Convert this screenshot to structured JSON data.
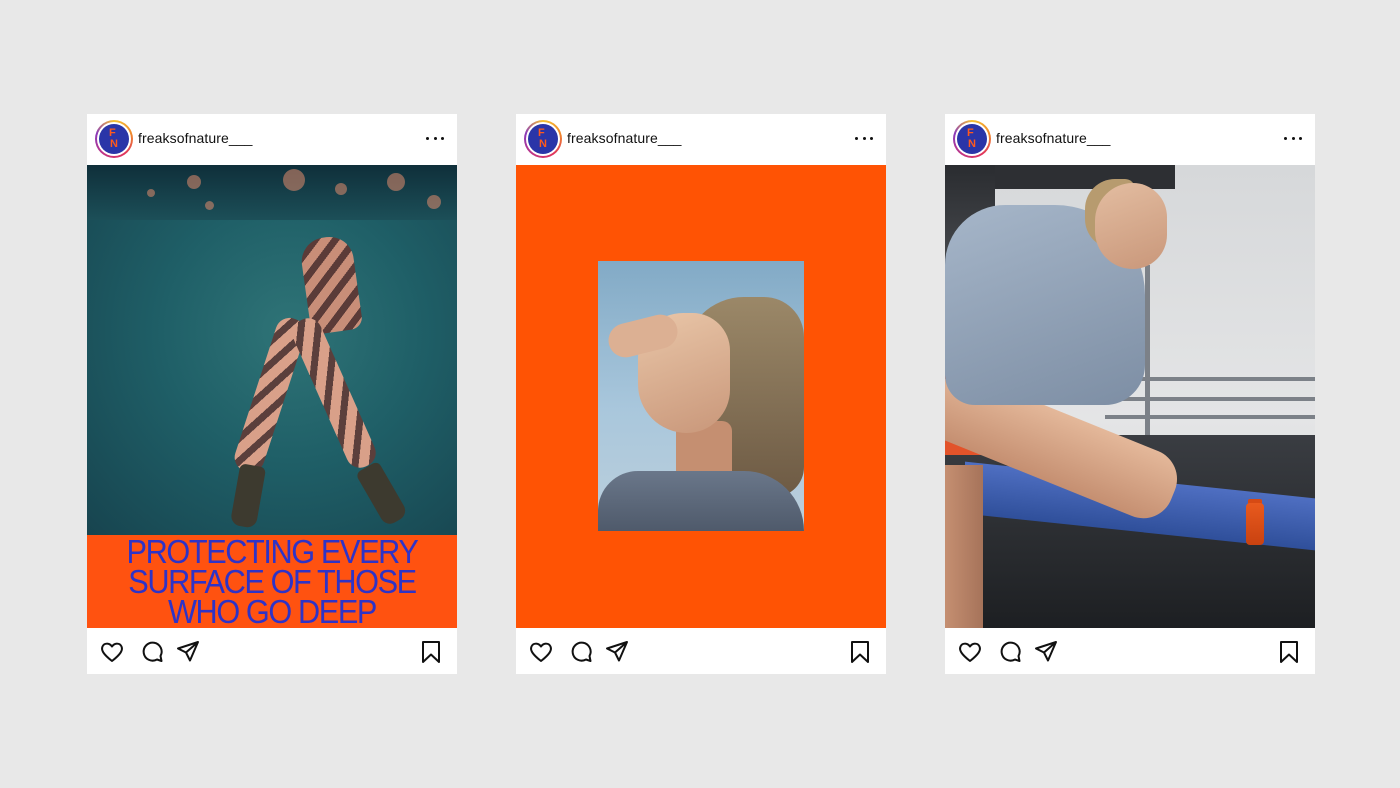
{
  "posts": [
    {
      "username": "freaksofnature___",
      "avatar_letters": {
        "top": "F",
        "bottom": "N"
      },
      "media": {
        "type": "photo-with-headline",
        "headline_lines": [
          "PROTECTING EVERY",
          "SURFACE OF THOSE",
          "WHO GO DEEP"
        ]
      }
    },
    {
      "username": "freaksofnature___",
      "avatar_letters": {
        "top": "F",
        "bottom": "N"
      },
      "media": {
        "type": "framed-portrait"
      }
    },
    {
      "username": "freaksofnature___",
      "avatar_letters": {
        "top": "F",
        "bottom": "N"
      },
      "media": {
        "type": "photo"
      }
    }
  ],
  "actions": {
    "icons": [
      "heart-icon",
      "comment-icon",
      "share-icon",
      "bookmark-icon"
    ]
  },
  "colors": {
    "background": "#e8e8e8",
    "brand_orange": "#ff5304",
    "brand_blue": "#2e33c7",
    "avatar_blue": "#2a35a8"
  }
}
